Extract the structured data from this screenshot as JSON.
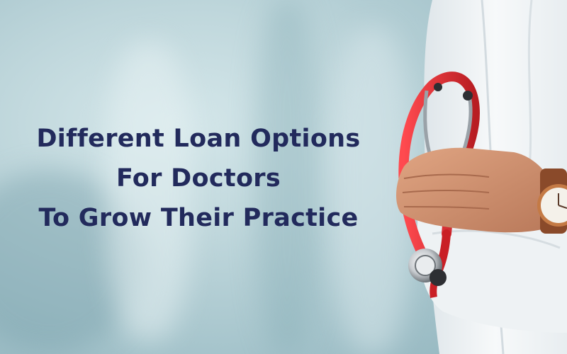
{
  "headline": {
    "line1": "Different Loan Options",
    "line2": "For Doctors",
    "line3": "To Grow Their Practice"
  },
  "colors": {
    "headline_text": "#222a5c",
    "background": "#b9d3d8",
    "coat": "#f2f4f6",
    "stethoscope": "#d8262c",
    "skin": "#c98a66",
    "watch_band": "#8a4a2a"
  },
  "photo": {
    "subject": "doctor-with-stethoscope-icon"
  }
}
